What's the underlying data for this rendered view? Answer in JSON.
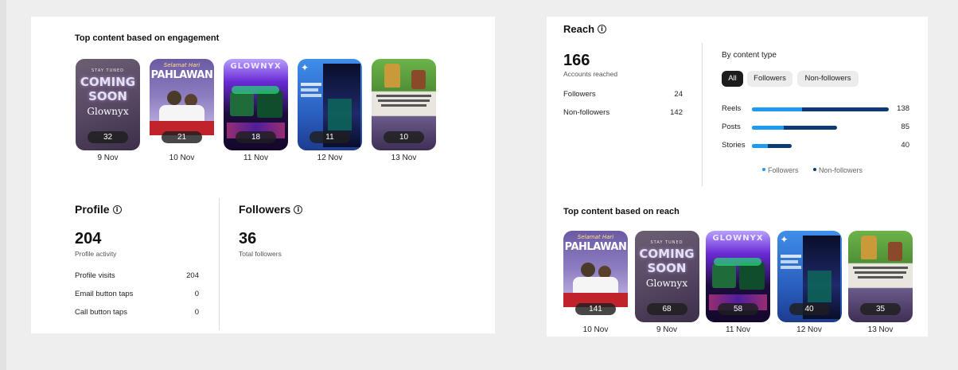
{
  "engagement": {
    "title": "Top content based on engagement",
    "posts": [
      {
        "count": "32",
        "date": "9 Nov",
        "art": "coming-soon",
        "l1": "STAY TUNED",
        "l2": "COMING",
        "l3": "SOON",
        "l4": "Glownyx"
      },
      {
        "count": "21",
        "date": "10 Nov",
        "art": "pahlawan",
        "l1": "Selamat Hari",
        "l2": "PAHLAWAN"
      },
      {
        "count": "18",
        "date": "11 Nov",
        "art": "glownyx",
        "l1": "GLOWNYX"
      },
      {
        "count": "11",
        "date": "12 Nov",
        "art": "night"
      },
      {
        "count": "10",
        "date": "13 Nov",
        "art": "oil"
      }
    ]
  },
  "profile": {
    "title": "Profile",
    "value": "204",
    "value_label": "Profile activity",
    "rows": [
      {
        "label": "Profile visits",
        "value": "204"
      },
      {
        "label": "Email button taps",
        "value": "0"
      },
      {
        "label": "Call button taps",
        "value": "0"
      }
    ]
  },
  "followers": {
    "title": "Followers",
    "value": "36",
    "value_label": "Total followers"
  },
  "reach": {
    "title": "Reach",
    "value": "166",
    "value_label": "Accounts reached",
    "rows": [
      {
        "label": "Followers",
        "value": "24"
      },
      {
        "label": "Non-followers",
        "value": "142"
      }
    ],
    "by_type": {
      "title": "By content type",
      "filters": [
        "All",
        "Followers",
        "Non-followers"
      ],
      "active_filter": "All",
      "colors": {
        "followers": "#1e9bf0",
        "non_followers": "#0c3b73"
      },
      "rows": [
        {
          "label": "Reels",
          "total": "138",
          "followers_frac": 0.27,
          "total_frac": 1.0
        },
        {
          "label": "Posts",
          "total": "85",
          "followers_frac": 0.28,
          "total_frac": 0.62
        },
        {
          "label": "Stories",
          "total": "40",
          "followers_frac": 0.3,
          "total_frac": 0.29
        }
      ],
      "legend": [
        "Followers",
        "Non-followers"
      ]
    }
  },
  "reach_top": {
    "title": "Top content based on reach",
    "posts": [
      {
        "count": "141",
        "date": "10 Nov",
        "art": "pahlawan",
        "l1": "Selamat Hari",
        "l2": "PAHLAWAN"
      },
      {
        "count": "68",
        "date": "9 Nov",
        "art": "coming-soon",
        "l1": "STAY TUNED",
        "l2": "COMING",
        "l3": "SOON",
        "l4": "Glownyx"
      },
      {
        "count": "58",
        "date": "11 Nov",
        "art": "glownyx",
        "l1": "GLOWNYX"
      },
      {
        "count": "40",
        "date": "12 Nov",
        "art": "night"
      },
      {
        "count": "35",
        "date": "13 Nov",
        "art": "oil"
      }
    ]
  }
}
